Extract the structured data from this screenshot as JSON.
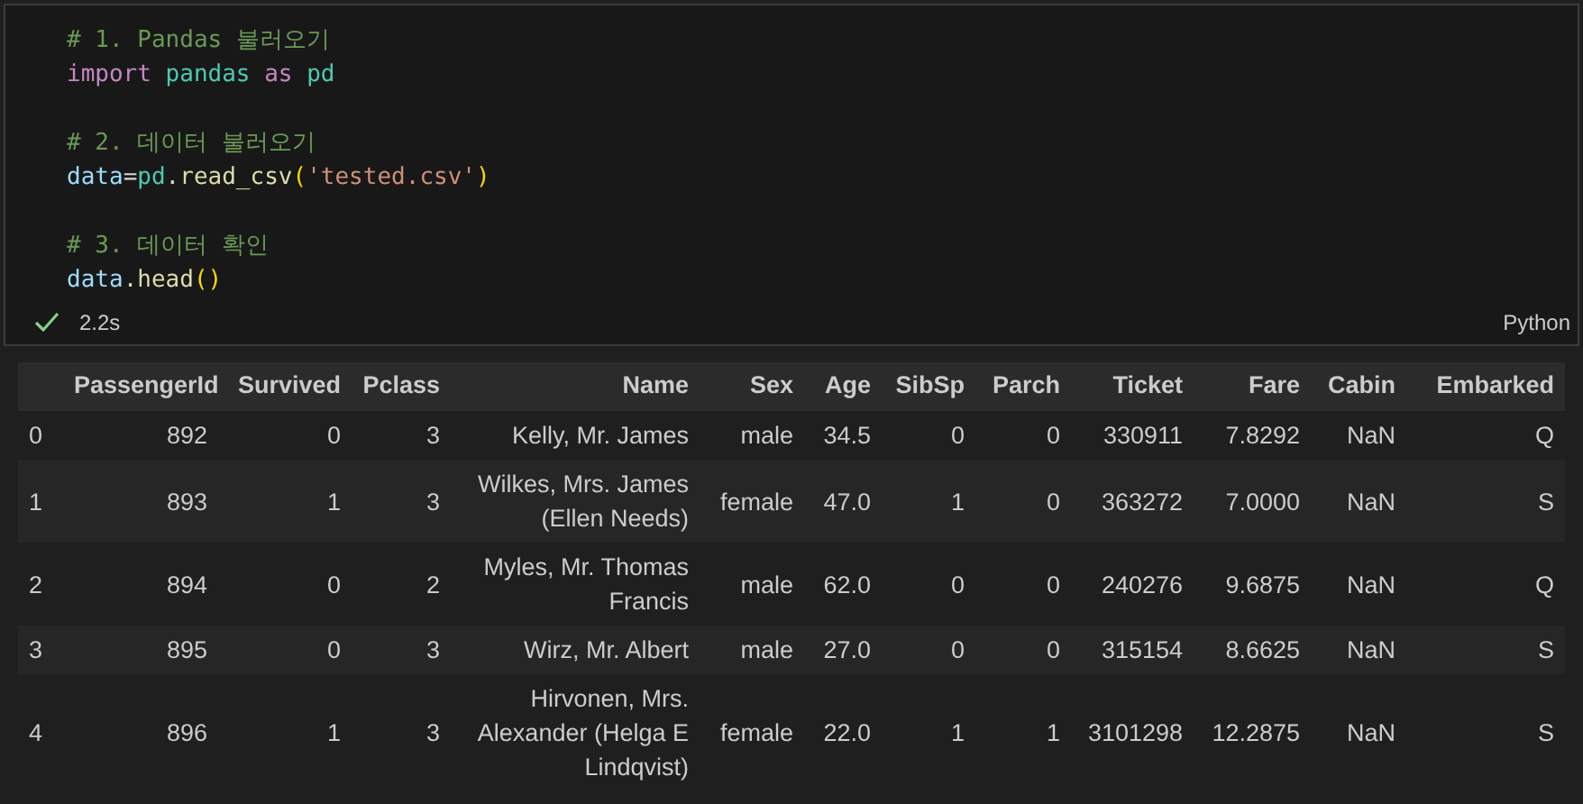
{
  "cell": {
    "code_lines": [
      {
        "kind": "code",
        "tokens": [
          {
            "text": "# 1. Pandas 불러오기",
            "kind": "comment"
          }
        ]
      },
      {
        "kind": "code",
        "tokens": [
          {
            "text": "import",
            "kind": "keyword"
          },
          {
            "text": " pandas",
            "kind": "module"
          },
          {
            "text": " as",
            "kind": "keyword"
          },
          {
            "text": " pd",
            "kind": "module"
          }
        ]
      },
      {
        "kind": "blank"
      },
      {
        "kind": "code",
        "tokens": [
          {
            "text": "# 2. 데이터 불러오기",
            "kind": "comment"
          }
        ]
      },
      {
        "kind": "code",
        "tokens": [
          {
            "text": "data",
            "kind": "variable"
          },
          {
            "text": "=",
            "kind": "plain"
          },
          {
            "text": "pd",
            "kind": "module"
          },
          {
            "text": ".",
            "kind": "plain"
          },
          {
            "text": "read_csv",
            "kind": "function"
          },
          {
            "text": "(",
            "kind": "bracket"
          },
          {
            "text": "'tested.csv'",
            "kind": "string"
          },
          {
            "text": ")",
            "kind": "bracket"
          }
        ]
      },
      {
        "kind": "blank"
      },
      {
        "kind": "code",
        "tokens": [
          {
            "text": "# 3. 데이터 확인",
            "kind": "comment"
          }
        ]
      },
      {
        "kind": "code",
        "tokens": [
          {
            "text": "data",
            "kind": "variable"
          },
          {
            "text": ".head",
            "kind": "function"
          },
          {
            "text": "()",
            "kind": "bracket"
          }
        ]
      }
    ],
    "status": {
      "succeeded": true,
      "duration": "2.2s",
      "language": "Python"
    }
  },
  "table": {
    "columns": [
      "",
      "PassengerId",
      "Survived",
      "Pclass",
      "Name",
      "Sex",
      "Age",
      "SibSp",
      "Parch",
      "Ticket",
      "Fare",
      "Cabin",
      "Embarked"
    ],
    "rows": [
      [
        "0",
        "892",
        "0",
        "3",
        "Kelly, Mr. James",
        "male",
        "34.5",
        "0",
        "0",
        "330911",
        "7.8292",
        "NaN",
        "Q"
      ],
      [
        "1",
        "893",
        "1",
        "3",
        "Wilkes, Mrs. James (Ellen Needs)",
        "female",
        "47.0",
        "1",
        "0",
        "363272",
        "7.0000",
        "NaN",
        "S"
      ],
      [
        "2",
        "894",
        "0",
        "2",
        "Myles, Mr. Thomas Francis",
        "male",
        "62.0",
        "0",
        "0",
        "240276",
        "9.6875",
        "NaN",
        "Q"
      ],
      [
        "3",
        "895",
        "0",
        "3",
        "Wirz, Mr. Albert",
        "male",
        "27.0",
        "0",
        "0",
        "315154",
        "8.6625",
        "NaN",
        "S"
      ],
      [
        "4",
        "896",
        "1",
        "3",
        "Hirvonen, Mrs. Alexander (Helga E Lindqvist)",
        "female",
        "22.0",
        "1",
        "1",
        "3101298",
        "12.2875",
        "NaN",
        "S"
      ]
    ]
  }
}
